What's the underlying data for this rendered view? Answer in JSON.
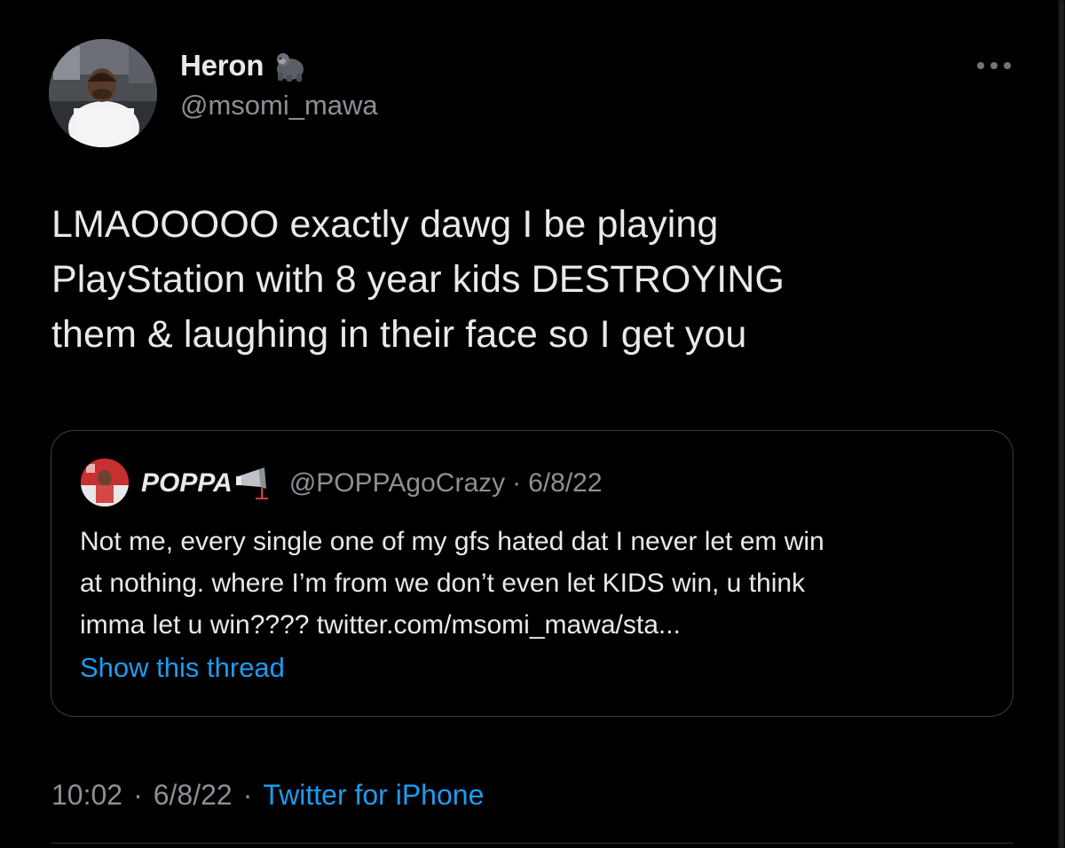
{
  "author": {
    "display_name": "Heron",
    "name_emoji": "gorilla-icon",
    "handle": "@msomi_mawa",
    "avatar": "avatar-photo"
  },
  "menu": {
    "icon": "more-horizontal-icon"
  },
  "tweet": {
    "text_lines": [
      "LMAOOOOO exactly dawg I be playing",
      "PlayStation with 8 year kids DESTROYING",
      "them & laughing in their face so I get you"
    ]
  },
  "quoted_tweet": {
    "display_name": "POPPA",
    "name_emoji": "megaphone-icon",
    "handle": "@POPPAgoCrazy",
    "separator": "·",
    "date": "6/8/22",
    "text_lines": [
      "Not me, every single one of my gfs hated dat I never let em win",
      "at nothing. where I’m from we don’t even let KIDS win, u think",
      "imma let u win???? twitter.com/msomi_mawa/sta..."
    ],
    "show_thread_label": "Show this thread"
  },
  "meta": {
    "time": "10:02",
    "separator": "·",
    "date": "6/8/22",
    "source": "Twitter for iPhone"
  },
  "colors": {
    "background": "#000000",
    "text": "#e7e9ea",
    "muted": "#8b9096",
    "link": "#1d9bf0",
    "border": "#3a3d40"
  }
}
